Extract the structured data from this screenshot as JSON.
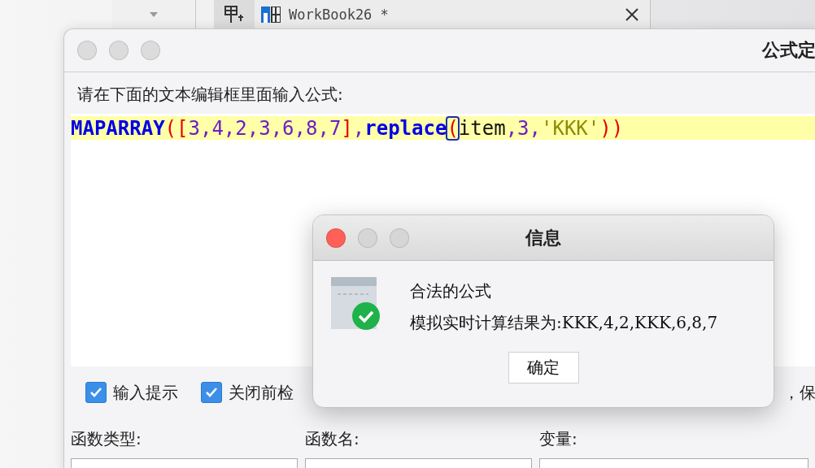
{
  "tab": {
    "title": "WorkBook26 *"
  },
  "formula_window": {
    "title": "公式定",
    "prompt": "请在下面的文本编辑框里面输入公式:",
    "tokens": [
      {
        "text": "MAPARRAY",
        "kind": "function",
        "matched": false
      },
      {
        "text": "(",
        "kind": "paren",
        "matched": false
      },
      {
        "text": "[",
        "kind": "paren",
        "matched": false
      },
      {
        "text": "3,4,2,3,6,8,7",
        "kind": "number",
        "matched": false
      },
      {
        "text": "]",
        "kind": "paren",
        "matched": false
      },
      {
        "text": ",",
        "kind": "number",
        "matched": false
      },
      {
        "text": "replace",
        "kind": "function",
        "matched": false
      },
      {
        "text": "(",
        "kind": "paren",
        "matched": true
      },
      {
        "text": "item",
        "kind": "identifier",
        "matched": false
      },
      {
        "text": ",3,",
        "kind": "number",
        "matched": false
      },
      {
        "text": "'KKK'",
        "kind": "string",
        "matched": false
      },
      {
        "text": "))",
        "kind": "paren",
        "matched": false
      }
    ],
    "options": [
      {
        "label": "输入提示",
        "checked": true
      },
      {
        "label": "关闭前检",
        "checked": true
      }
    ],
    "option_tail": "，保",
    "columns": [
      {
        "label": "函数类型:"
      },
      {
        "label": "函数名:"
      },
      {
        "label": "变量:"
      }
    ]
  },
  "dialog": {
    "title": "信息",
    "lines": [
      "合法的公式",
      "模拟实时计算结果为:KKK,4,2,KKK,6,8,7"
    ],
    "button": "确定"
  }
}
